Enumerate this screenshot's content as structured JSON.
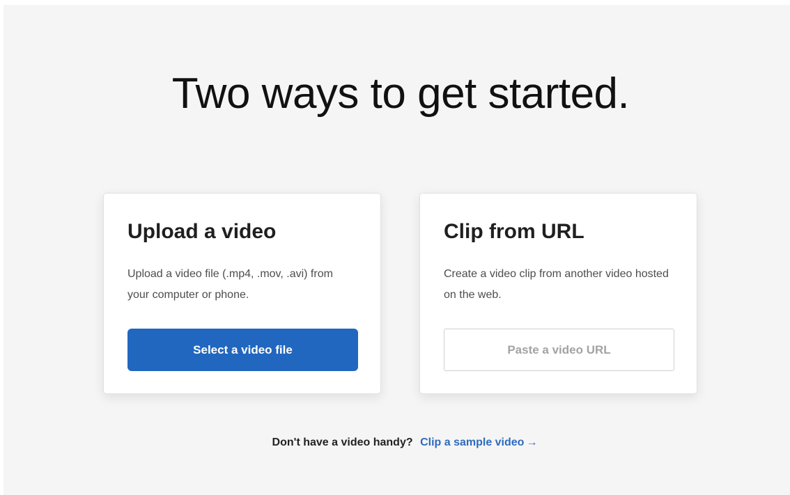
{
  "headline": "Two ways to get started.",
  "cards": {
    "upload": {
      "title": "Upload a video",
      "description": "Upload a video file (.mp4, .mov, .avi) from your computer or phone.",
      "button_label": "Select a video file"
    },
    "url": {
      "title": "Clip from URL",
      "description": "Create a video clip from another video hosted on the web.",
      "input_placeholder": "Paste a video URL",
      "input_value": ""
    }
  },
  "footer": {
    "prompt": "Don't have a video handy?",
    "link_label": "Clip a sample video",
    "link_arrow": "→",
    "arrow_icon": "arrow-right-icon"
  },
  "colors": {
    "background": "#f5f5f5",
    "primary_button": "#2167bf",
    "link": "#2e6bbf",
    "heading": "#111111"
  }
}
